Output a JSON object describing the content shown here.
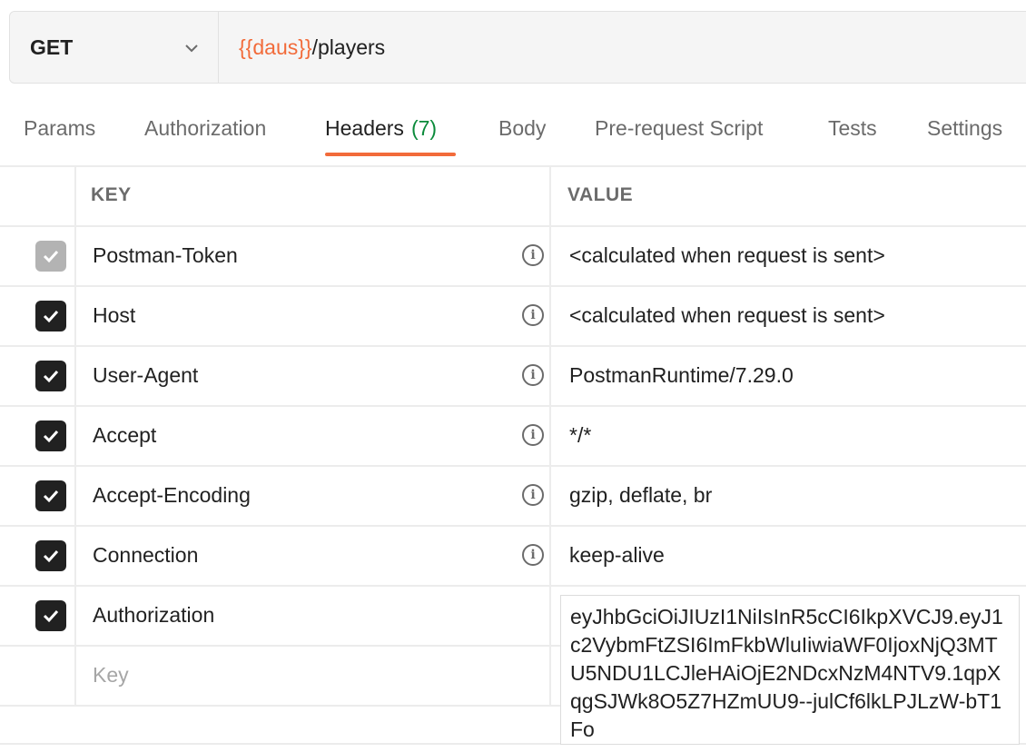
{
  "request": {
    "method": "GET",
    "url_variable": "{{daus}}",
    "url_path": "/players"
  },
  "tabs": [
    {
      "label": "Params"
    },
    {
      "label": "Authorization"
    },
    {
      "label": "Headers",
      "count": "(7)",
      "active": true
    },
    {
      "label": "Body"
    },
    {
      "label": "Pre-request Script"
    },
    {
      "label": "Tests"
    },
    {
      "label": "Settings"
    }
  ],
  "table": {
    "columns": {
      "key": "KEY",
      "value": "VALUE"
    },
    "rows": [
      {
        "checked": true,
        "disabled": true,
        "key": "Postman-Token",
        "info": true,
        "value": "<calculated when request is sent>"
      },
      {
        "checked": true,
        "key": "Host",
        "info": true,
        "value": "<calculated when request is sent>"
      },
      {
        "checked": true,
        "key": "User-Agent",
        "info": true,
        "value": "PostmanRuntime/7.29.0"
      },
      {
        "checked": true,
        "key": "Accept",
        "info": true,
        "value": "*/*"
      },
      {
        "checked": true,
        "key": "Accept-Encoding",
        "info": true,
        "value": "gzip, deflate, br"
      },
      {
        "checked": true,
        "key": "Connection",
        "info": true,
        "value": "keep-alive"
      },
      {
        "checked": true,
        "key": "Authorization",
        "info": false,
        "value": "eyJhbGciOiJIUzI1NiIsInR5cCI6IkpXVCJ9.eyJ1c2VybmFtZSI6ImFkbWluIiwiaWF0IjoxNjQ3MTU5NDU1LCJleHAiOjE2NDcxNzM4NTV9.1qpXqgSJWk8O5Z7HZmUU9--julCf6lkLPJLzW-bT1Fo"
      }
    ],
    "new_key_placeholder": "Key"
  },
  "colors": {
    "accent": "#f26b3a",
    "count_green": "#0a8a3a"
  }
}
